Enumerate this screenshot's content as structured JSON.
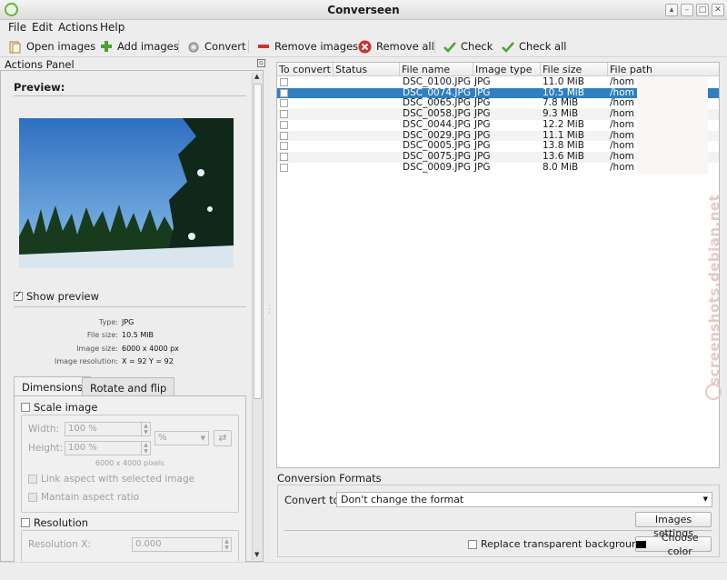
{
  "window": {
    "title": "Converseen"
  },
  "menu": [
    "File",
    "Edit",
    "Actions",
    "Help"
  ],
  "toolbar": {
    "open_images": "Open images",
    "add_images": "Add images",
    "convert": "Convert",
    "remove_images": "Remove images",
    "remove_all": "Remove all",
    "check": "Check",
    "check_all": "Check all"
  },
  "actions_panel": {
    "title": "Actions Panel",
    "preview_title": "Preview:",
    "show_preview_label": "Show preview",
    "show_preview_checked": true,
    "info": {
      "type_label": "Type:",
      "type_value": "JPG",
      "size_label": "File size:",
      "size_value": "10.5 MiB",
      "dims_label": "Image size:",
      "dims_value": "6000 x 4000 px",
      "res_label": "Image resolution:",
      "res_value": "X = 92 Y = 92"
    },
    "tabs": [
      "Dimensions",
      "Rotate and flip"
    ],
    "dimensions": {
      "scale_image_label": "Scale image",
      "width_label": "Width:",
      "width_value": "100 %",
      "height_label": "Height:",
      "height_value": "100 %",
      "unit_value": "%",
      "pixels_note": "6000 x 4000 pixels",
      "link_aspect_label": "Link aspect with selected image",
      "maintain_aspect_label": "Mantain aspect ratio",
      "resolution_label": "Resolution",
      "resolution_x_label": "Resolution X:",
      "resolution_x_value": "0.000"
    }
  },
  "table": {
    "columns": [
      "To convert",
      "Status",
      "File name",
      "Image type",
      "File size",
      "File path"
    ],
    "rows": [
      {
        "name": "DSC_0100.JPG",
        "type": "JPG",
        "size": "11.0 MiB",
        "path": "/hom"
      },
      {
        "name": "DSC_0074.JPG",
        "type": "JPG",
        "size": "10.5 MiB",
        "path": "/hom",
        "selected": true
      },
      {
        "name": "DSC_0065.JPG",
        "type": "JPG",
        "size": "7.8 MiB",
        "path": "/hom"
      },
      {
        "name": "DSC_0058.JPG",
        "type": "JPG",
        "size": "9.3 MiB",
        "path": "/hom"
      },
      {
        "name": "DSC_0044.JPG",
        "type": "JPG",
        "size": "12.2 MiB",
        "path": "/hom"
      },
      {
        "name": "DSC_0029.JPG",
        "type": "JPG",
        "size": "11.1 MiB",
        "path": "/hom"
      },
      {
        "name": "DSC_0005.JPG",
        "type": "JPG",
        "size": "13.8 MiB",
        "path": "/hom"
      },
      {
        "name": "DSC_0075.JPG",
        "type": "JPG",
        "size": "13.6 MiB",
        "path": "/hom"
      },
      {
        "name": "DSC_0009.JPG",
        "type": "JPG",
        "size": "8.0 MiB",
        "path": "/hom"
      }
    ]
  },
  "conversion": {
    "title": "Conversion Formats",
    "convert_to_label": "Convert to:",
    "convert_to_value": "Don't change the format",
    "images_settings": "Images settings",
    "replace_transparent": "Replace transparent background",
    "choose_color": "Choose color"
  },
  "watermark": "screenshots.debian.net",
  "colors": {
    "selection": "#2f7fc1",
    "accent_green": "#4aa52e",
    "remove_red": "#d32f2f"
  }
}
